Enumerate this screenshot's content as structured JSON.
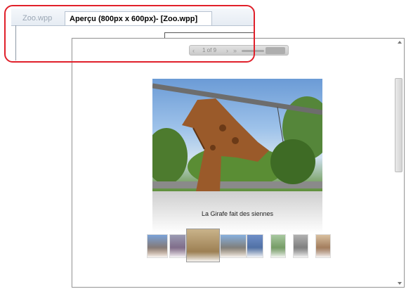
{
  "tabs": [
    {
      "label": "Zoo.wpp"
    },
    {
      "label": "Aperçu (800px x 600px)- [Zoo.wpp]"
    }
  ],
  "pager": {
    "prev_icon": "‹",
    "text": "1 of 9",
    "next_icon": "›",
    "last_icon": "»"
  },
  "slideshow": {
    "caption": "La Girafe fait des siennes"
  },
  "colors": {
    "annotation": "#e0202a",
    "tab_border": "#b7c3d1",
    "accent_sky": "#6b9bd6"
  }
}
